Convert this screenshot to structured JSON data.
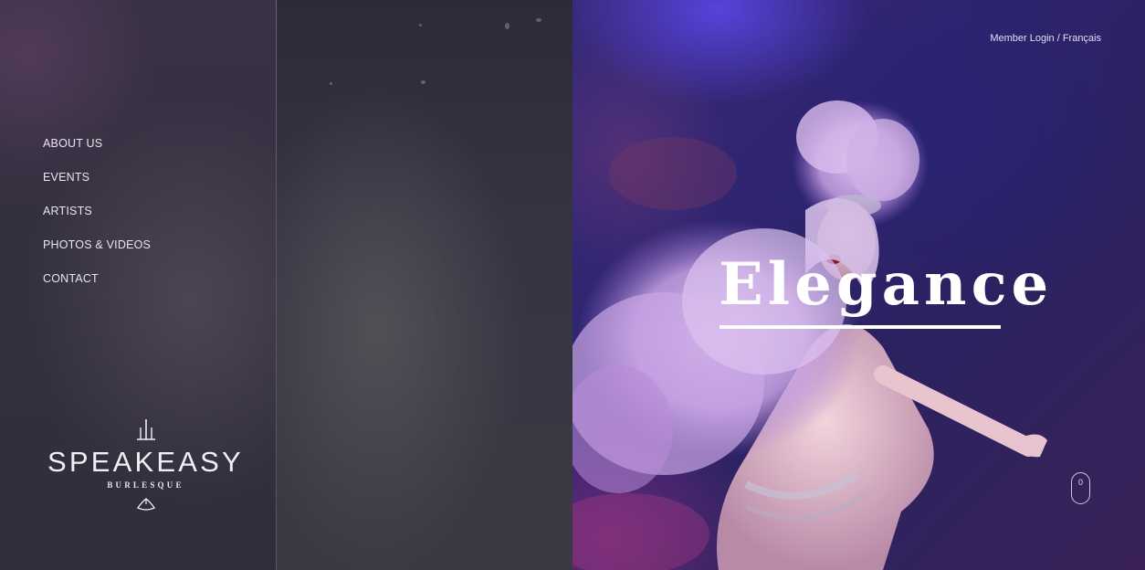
{
  "nav": {
    "items": [
      {
        "label": "ABOUT US"
      },
      {
        "label": "EVENTS"
      },
      {
        "label": "ARTISTS"
      },
      {
        "label": "PHOTOS & VIDEOS"
      },
      {
        "label": "CONTACT"
      }
    ]
  },
  "logo": {
    "word": "SPEAKEASY",
    "sub": "BURLESQUE"
  },
  "header": {
    "member_login": "Member Login",
    "separator": " / ",
    "language": "Français"
  },
  "hero": {
    "headline": "Elegance",
    "image": "burlesque-dancer-with-lavender-feathers"
  },
  "scroll": {
    "icon": "mouse-scroll-icon",
    "value": "0"
  },
  "colors": {
    "hero_tint": "#2e2470",
    "nav_text": "#e9e6ee",
    "feather": "#c8a6e6"
  }
}
